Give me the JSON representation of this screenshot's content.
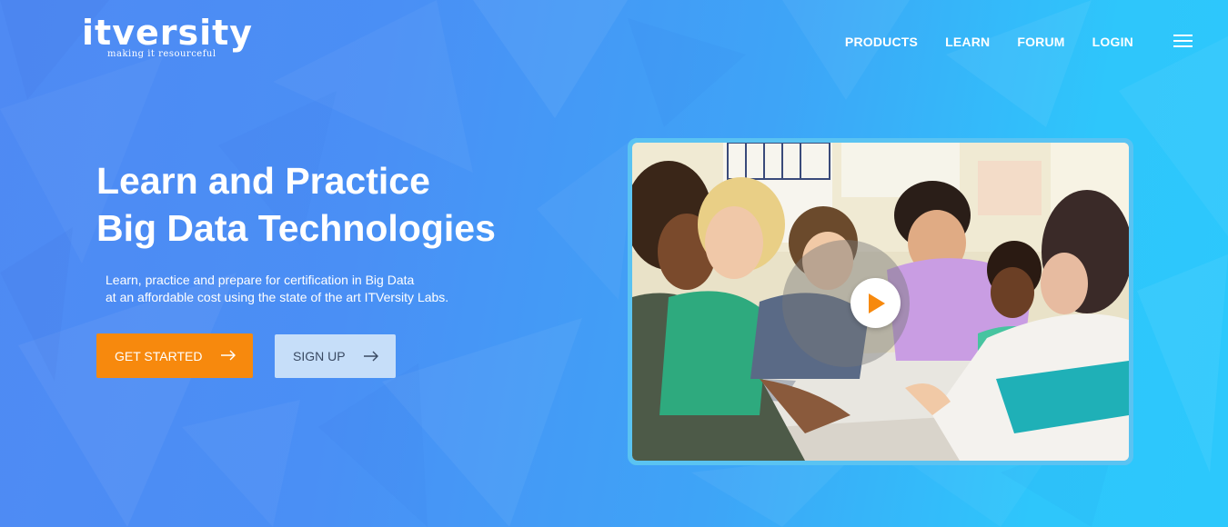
{
  "brand": {
    "name": "itversity",
    "tagline": "making it resourceful"
  },
  "nav": {
    "items": [
      "PRODUCTS",
      "LEARN",
      "FORUM",
      "LOGIN"
    ]
  },
  "hero": {
    "title_line1": "Learn and Practice",
    "title_line2": "Big Data Technologies",
    "subtitle_line1": "Learn, practice and prepare for certification in Big Data",
    "subtitle_line2": "at an affordable cost using the state of the art ITVersity Labs."
  },
  "buttons": {
    "get_started": "GET STARTED",
    "sign_up": "SIGN UP"
  },
  "icons": {
    "menu": "hamburger-menu-icon",
    "arrow": "arrow-right-icon",
    "play": "play-icon"
  },
  "colors": {
    "primary_button": "#f7890d",
    "secondary_button": "#c6def9",
    "play_icon": "#f7890d"
  }
}
